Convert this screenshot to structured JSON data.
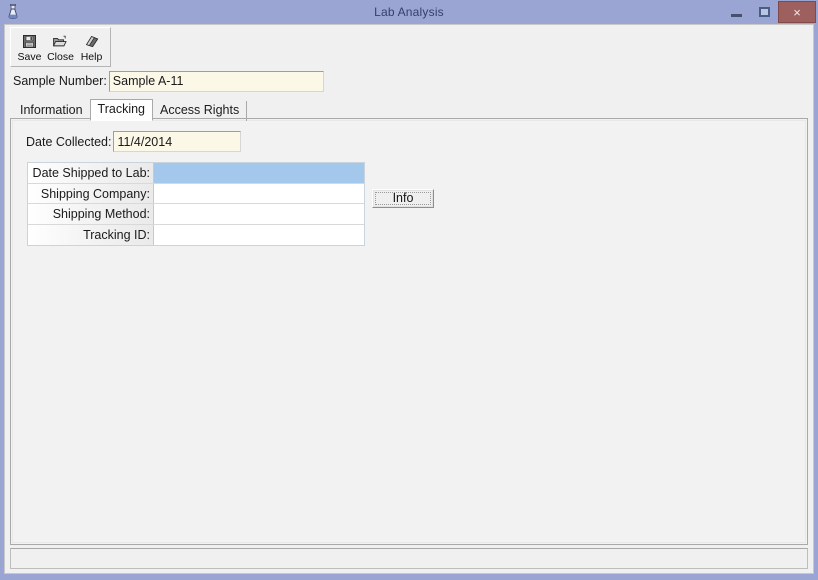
{
  "window": {
    "title": "Lab Analysis",
    "icon": "flask-icon",
    "controls": {
      "minimize": "minimize-icon",
      "maximize": "maximize-icon",
      "close_label": "×"
    },
    "colors": {
      "title_bar": "#9ba5d4",
      "title_text": "#33406b",
      "close_button": "#9e5f5f",
      "client_background": "#f0f0f0",
      "field_background": "#fbf8e8",
      "selection": "#a4c7ec"
    }
  },
  "toolbar": {
    "buttons": [
      {
        "label": "Save",
        "icon": "floppy-disk-icon"
      },
      {
        "label": "Close",
        "icon": "open-folder-icon"
      },
      {
        "label": "Help",
        "icon": "book-icon"
      }
    ]
  },
  "header": {
    "sample_number_label": "Sample Number:",
    "sample_number_value": "Sample A-11",
    "sample_number_placeholder": ""
  },
  "tabs": [
    {
      "label": "Information",
      "active": false
    },
    {
      "label": "Tracking",
      "active": true
    },
    {
      "label": "Access Rights",
      "active": false
    }
  ],
  "tracking": {
    "date_collected_label": "Date Collected:",
    "date_collected_value": "11/4/2014",
    "date_collected_placeholder": "",
    "grid_rows": [
      {
        "name": "Date Shipped to Lab:",
        "value": "",
        "selected": true
      },
      {
        "name": "Shipping Company:",
        "value": "",
        "selected": false
      },
      {
        "name": "Shipping Method:",
        "value": "",
        "selected": false
      },
      {
        "name": "Tracking ID:",
        "value": "",
        "selected": false
      }
    ],
    "info_button_label": "Info"
  },
  "statusbar": {
    "text": ""
  }
}
